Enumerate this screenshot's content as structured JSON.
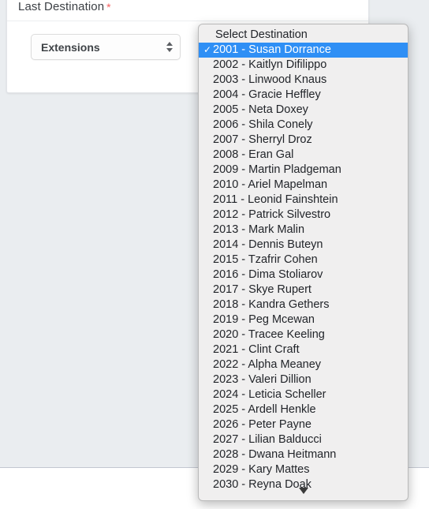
{
  "form": {
    "label": "Last Destination",
    "required_marker": "*",
    "select": {
      "value": "Extensions",
      "stepper_icon": "stepper-updown-icon"
    }
  },
  "dropdown": {
    "header_option": "Select Destination",
    "selected_value": "2001 - Susan Dorrance",
    "check_glyph": "✓",
    "scroll_down_icon": "triangle-down-icon",
    "highlight_color": "#2f8ff5",
    "panel_color": "#f0efef",
    "options": [
      "2001 - Susan Dorrance",
      "2002 - Kaitlyn Difilippo",
      "2003 - Linwood Knaus",
      "2004 - Gracie Heffley",
      "2005 - Neta Doxey",
      "2006 - Shila Conely",
      "2007 - Sherryl Droz",
      "2008 - Eran Gal",
      "2009 - Martin Pladgeman",
      "2010 - Ariel Mapelman",
      "2011 - Leonid Fainshtein",
      "2012 - Patrick Silvestro",
      "2013 - Mark Malin",
      "2014 - Dennis Buteyn",
      "2015 - Tzafrir Cohen",
      "2016 - Dima Stoliarov",
      "2017 - Skye Rupert",
      "2018 - Kandra Gethers",
      "2019 - Peg Mcewan",
      "2020 - Tracee Keeling",
      "2021 - Clint Craft",
      "2022 - Alpha Meaney",
      "2023 - Valeri Dillion",
      "2024 - Leticia Scheller",
      "2025 - Ardell Henkle",
      "2026 - Peter Payne",
      "2027 - Lilian Balducci",
      "2028 - Dwana Heitmann",
      "2029 - Kary Mattes",
      "2030 - Reyna Doak"
    ]
  },
  "colors": {
    "page_background": "#eaedf0",
    "card_background": "#ffffff",
    "required_star": "#f35e5e"
  }
}
